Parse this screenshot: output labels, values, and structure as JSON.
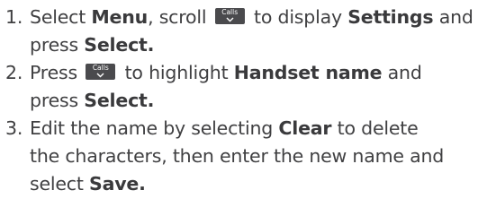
{
  "steps": [
    {
      "number": "1.",
      "line1": {
        "t1": "Select ",
        "b1": "Menu",
        "t2": ", scroll ",
        "t3": " to display ",
        "b2": "Settings",
        "t4": " and"
      },
      "line2": {
        "t1": "press ",
        "b1": "Select."
      }
    },
    {
      "number": "2.",
      "line1": {
        "t1": "Press ",
        "t2": " to highlight ",
        "b1": "Handset name",
        "t3": " and"
      },
      "line2": {
        "t1": "press ",
        "b1": "Select."
      }
    },
    {
      "number": "3.",
      "line1": {
        "t1": "Edit the name by selecting ",
        "b1": "Clear",
        "t2": " to delete"
      },
      "line2": {
        "t1": "the characters, then enter the new name and"
      },
      "line3": {
        "t1": "select ",
        "b1": "Save."
      }
    }
  ],
  "key": {
    "label": "Calls",
    "icon": "chevron-down-icon",
    "color": "#4a4a4d"
  },
  "colors": {
    "text": "#404042",
    "background": "#ffffff"
  }
}
